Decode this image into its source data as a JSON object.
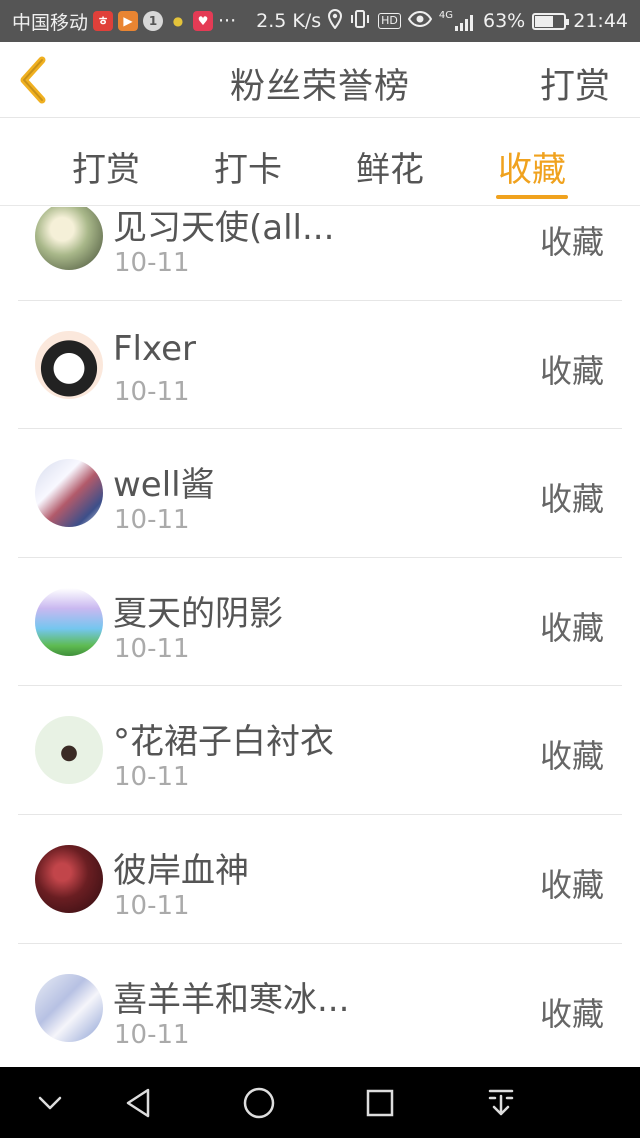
{
  "status_bar": {
    "carrier": "中国移动",
    "ellipsis": "···",
    "speed": "2.5 K/s",
    "hd": "HD",
    "network": "4G",
    "battery": "63%",
    "battery_level": 0.63,
    "time": "21:44"
  },
  "header": {
    "title": "粉丝荣誉榜",
    "action": "打赏"
  },
  "tabs": [
    {
      "label": "打赏",
      "active": false
    },
    {
      "label": "打卡",
      "active": false
    },
    {
      "label": "鲜花",
      "active": false
    },
    {
      "label": "收藏",
      "active": true
    }
  ],
  "list": [
    {
      "name": "见习天使(all...",
      "date": "10-11",
      "action": "收藏"
    },
    {
      "name": "Flxer",
      "date": "10-11",
      "action": "收藏"
    },
    {
      "name": "well酱",
      "date": "10-11",
      "action": "收藏"
    },
    {
      "name": "夏天的阴影",
      "date": "10-11",
      "action": "收藏"
    },
    {
      "name": "°花裙子白衬衣",
      "date": "10-11",
      "action": "收藏"
    },
    {
      "name": "彼岸血神",
      "date": "10-11",
      "action": "收藏"
    },
    {
      "name": "喜羊羊和寒冰...",
      "date": "10-11",
      "action": "收藏"
    }
  ],
  "colors": {
    "accent": "#f0a21e",
    "status_bar": "#555555",
    "nav_bar": "#000000"
  },
  "icons": {
    "back": "chevron-left-icon",
    "nav": [
      "chevron-down-icon",
      "triangle-back-icon",
      "circle-home-icon",
      "square-recents-icon",
      "download-tray-icon"
    ]
  }
}
